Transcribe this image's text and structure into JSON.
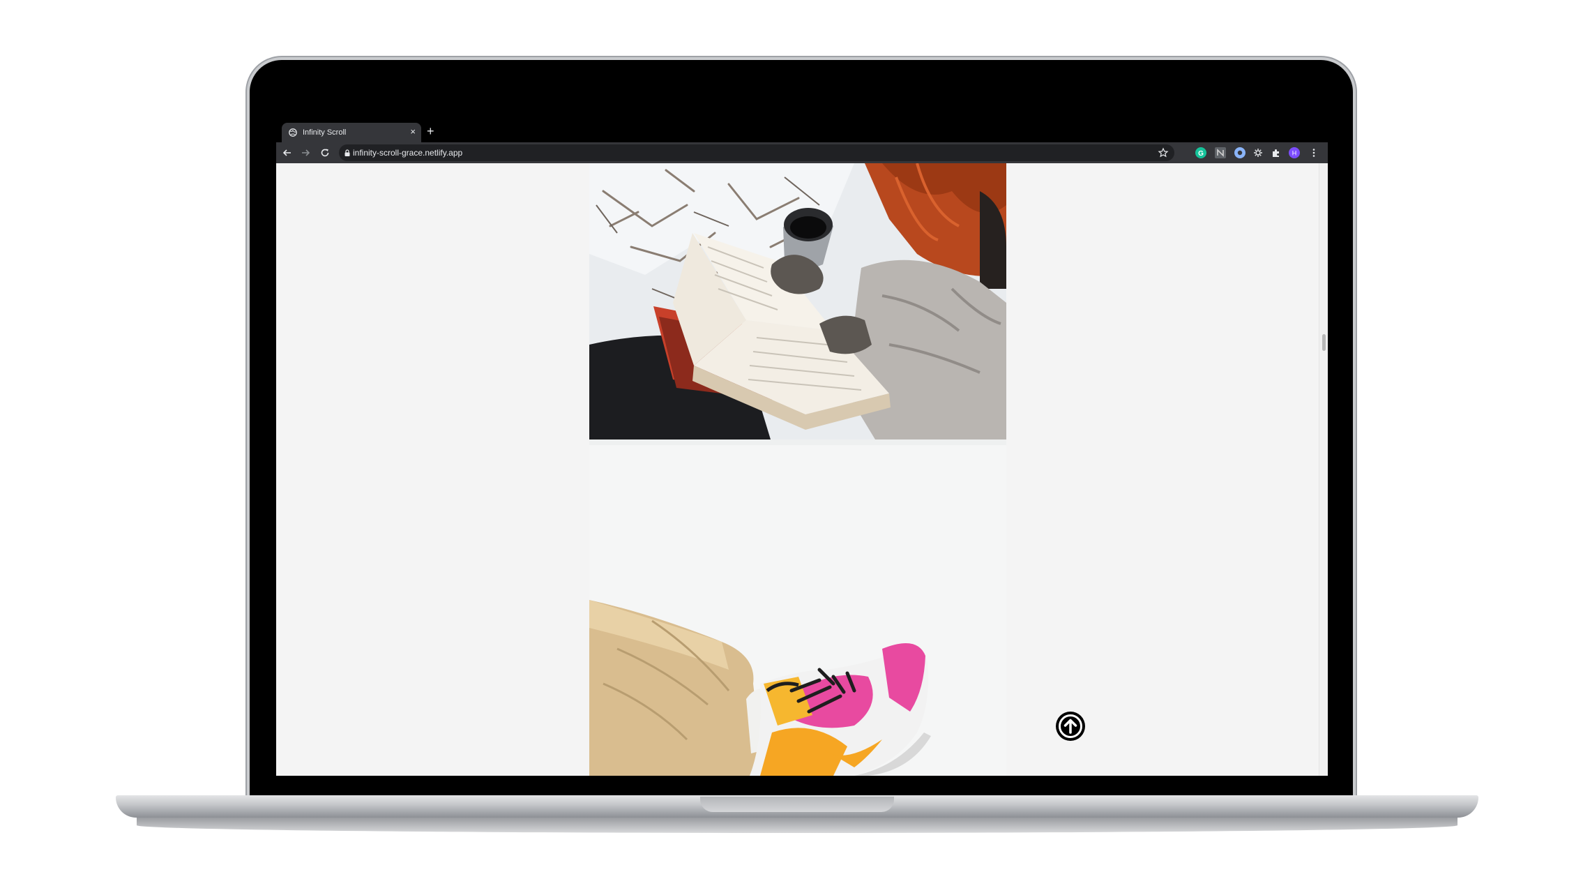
{
  "browser": {
    "tab": {
      "title": "Infinity Scroll",
      "close_glyph": "×",
      "favicon": "globe-icon"
    },
    "new_tab_glyph": "+",
    "toolbar": {
      "back_icon": "arrow-left-icon",
      "forward_icon": "arrow-right-icon",
      "reload_icon": "reload-icon",
      "url": "infinity-scroll-grace.netlify.app",
      "lock_icon": "lock-icon",
      "bookmark_icon": "star-icon"
    },
    "extensions": [
      {
        "name": "grammarly-extension-icon",
        "color": "#15c39a"
      },
      {
        "name": "notion-extension-icon",
        "color": "#9aa0a6"
      },
      {
        "name": "circle-extension-icon",
        "color": "#8ab4f8"
      },
      {
        "name": "settings-extension-icon",
        "color": "#e8eaed"
      },
      {
        "name": "puzzle-extensions-icon",
        "color": "#e8eaed"
      }
    ],
    "profile": {
      "initial": "H",
      "color": "#7c4dff"
    },
    "menu_icon": "kebab-menu-icon"
  },
  "page": {
    "background": "#f4f4f4",
    "photos": [
      {
        "subject": "book-and-thermos-photo"
      },
      {
        "subject": "pink-sneaker-photo"
      }
    ],
    "scroll_top_button": {
      "icon": "arrow-up-circle-icon"
    }
  }
}
